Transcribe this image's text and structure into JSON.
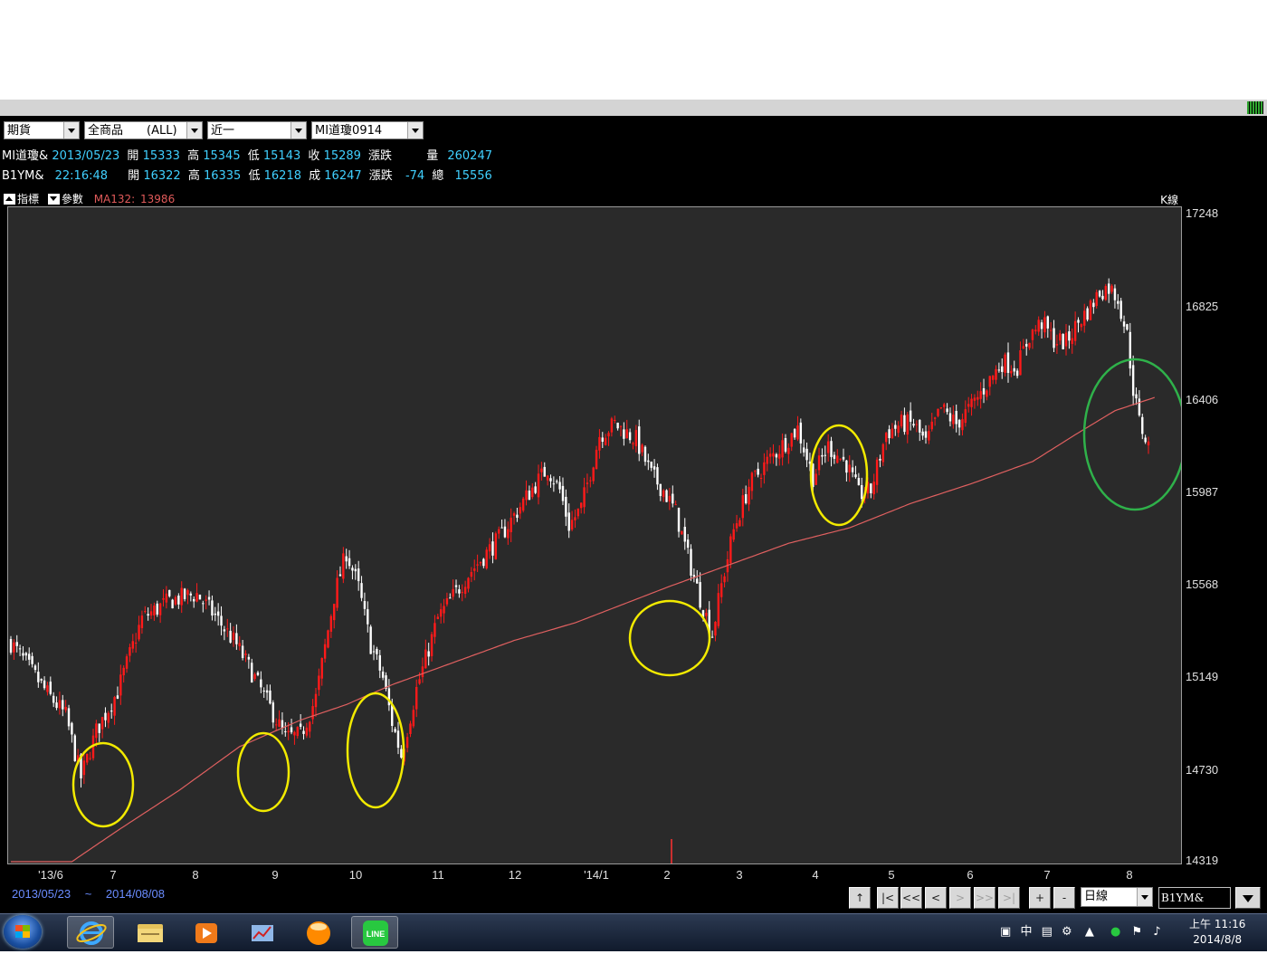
{
  "toolbar": {
    "market_select": "期貨",
    "product_select": "全商品　　(ALL)",
    "period_select": "近一",
    "contract_select": "MI道瓊0914"
  },
  "info_row1": {
    "symbol": "MI道瓊&",
    "date": "2013/05/23",
    "open_label": "開",
    "open": "15333",
    "high_label": "高",
    "high": "15345",
    "low_label": "低",
    "low": "15143",
    "close_label": "收",
    "close": "15289",
    "change_label": "漲跌",
    "volume_label": "量",
    "volume": "260247"
  },
  "info_row2": {
    "symbol": "B1YM&",
    "time": "22:16:48",
    "open_label": "開",
    "open": "16322",
    "high_label": "高",
    "high": "16335",
    "low_label": "低",
    "low": "16218",
    "last_label": "成",
    "last": "16247",
    "change_label": "漲跌",
    "change": "-74",
    "total_label": "總",
    "total": "15556"
  },
  "indicator_bar": {
    "indicator_label": "指標",
    "param_label": "參數",
    "ma_label": "MA132:",
    "ma_value": "13986",
    "chart_kind": "K線"
  },
  "footer": {
    "range_start": "2013/05/23",
    "range_sep": "~",
    "range_end": "2014/08/08",
    "nav_up": "↑",
    "nav_first": "|<",
    "nav_prev_page": "<<",
    "nav_prev": "<",
    "nav_next": ">",
    "nav_next_page": ">>",
    "nav_last": ">|",
    "zoom_in": "+",
    "zoom_out": "-",
    "period_select": "日線",
    "symbol_input": "B1YM&"
  },
  "taskbar": {
    "tray_ime": "中",
    "clock_time": "上午 11:16",
    "clock_date": "2014/8/8"
  },
  "colors": {
    "up_candle": "#ff1a1a",
    "down_candle": "#ffffff",
    "ma_line": "#e06060",
    "plot_bg": "#2a2a2a",
    "highlight_yellow": "#f2ea00",
    "highlight_green": "#2fb14a"
  },
  "chart_data": {
    "type": "candlestick",
    "series": [
      {
        "name": "MA132",
        "kind": "line"
      }
    ],
    "y_ticks": [
      14319,
      14730,
      15149,
      15568,
      15987,
      16406,
      16825,
      17248
    ],
    "ylim": [
      14319,
      17248
    ],
    "x_ticks": [
      "'13/6",
      "7",
      "8",
      "9",
      "10",
      "11",
      "12",
      "'14/1",
      "2",
      "3",
      "4",
      "5",
      "6",
      "7",
      "8"
    ],
    "close_path": [
      [
        0,
        15310
      ],
      [
        12,
        15080
      ],
      [
        18,
        14980
      ],
      [
        23,
        14700
      ],
      [
        28,
        14910
      ],
      [
        35,
        15090
      ],
      [
        43,
        15420
      ],
      [
        52,
        15500
      ],
      [
        61,
        15530
      ],
      [
        67,
        15430
      ],
      [
        74,
        15300
      ],
      [
        80,
        15150
      ],
      [
        86,
        14990
      ],
      [
        90,
        14880
      ],
      [
        95,
        14890
      ],
      [
        100,
        15060
      ],
      [
        106,
        15520
      ],
      [
        110,
        15720
      ],
      [
        114,
        15560
      ],
      [
        118,
        15300
      ],
      [
        122,
        15150
      ],
      [
        125,
        14950
      ],
      [
        128,
        14800
      ],
      [
        133,
        15100
      ],
      [
        140,
        15420
      ],
      [
        150,
        15620
      ],
      [
        160,
        15780
      ],
      [
        170,
        15990
      ],
      [
        176,
        16100
      ],
      [
        180,
        16000
      ],
      [
        183,
        15840
      ],
      [
        187,
        15920
      ],
      [
        193,
        16250
      ],
      [
        198,
        16300
      ],
      [
        205,
        16230
      ],
      [
        210,
        16070
      ],
      [
        214,
        16000
      ],
      [
        218,
        15900
      ],
      [
        222,
        15700
      ],
      [
        226,
        15510
      ],
      [
        230,
        15350
      ],
      [
        233,
        15570
      ],
      [
        237,
        15820
      ],
      [
        242,
        16020
      ],
      [
        248,
        16130
      ],
      [
        254,
        16220
      ],
      [
        258,
        16280
      ],
      [
        263,
        16060
      ],
      [
        268,
        16200
      ],
      [
        274,
        16120
      ],
      [
        278,
        15980
      ],
      [
        282,
        16000
      ],
      [
        287,
        16260
      ],
      [
        292,
        16300
      ],
      [
        296,
        16300
      ],
      [
        300,
        16210
      ],
      [
        305,
        16370
      ],
      [
        310,
        16300
      ],
      [
        315,
        16380
      ],
      [
        320,
        16480
      ],
      [
        325,
        16580
      ],
      [
        330,
        16560
      ],
      [
        334,
        16700
      ],
      [
        338,
        16760
      ],
      [
        342,
        16680
      ],
      [
        346,
        16670
      ],
      [
        350,
        16760
      ],
      [
        354,
        16830
      ],
      [
        357,
        16900
      ],
      [
        360,
        16920
      ],
      [
        363,
        16870
      ],
      [
        366,
        16700
      ],
      [
        368,
        16460
      ],
      [
        370,
        16310
      ],
      [
        373,
        16200
      ]
    ],
    "ma_path": [
      [
        20,
        14319
      ],
      [
        35,
        14460
      ],
      [
        55,
        14640
      ],
      [
        75,
        14840
      ],
      [
        95,
        14960
      ],
      [
        110,
        15030
      ],
      [
        125,
        15120
      ],
      [
        145,
        15220
      ],
      [
        165,
        15320
      ],
      [
        185,
        15400
      ],
      [
        200,
        15480
      ],
      [
        215,
        15560
      ],
      [
        235,
        15660
      ],
      [
        255,
        15760
      ],
      [
        275,
        15830
      ],
      [
        295,
        15940
      ],
      [
        315,
        16030
      ],
      [
        335,
        16130
      ],
      [
        350,
        16260
      ],
      [
        362,
        16360
      ],
      [
        375,
        16420
      ]
    ]
  }
}
